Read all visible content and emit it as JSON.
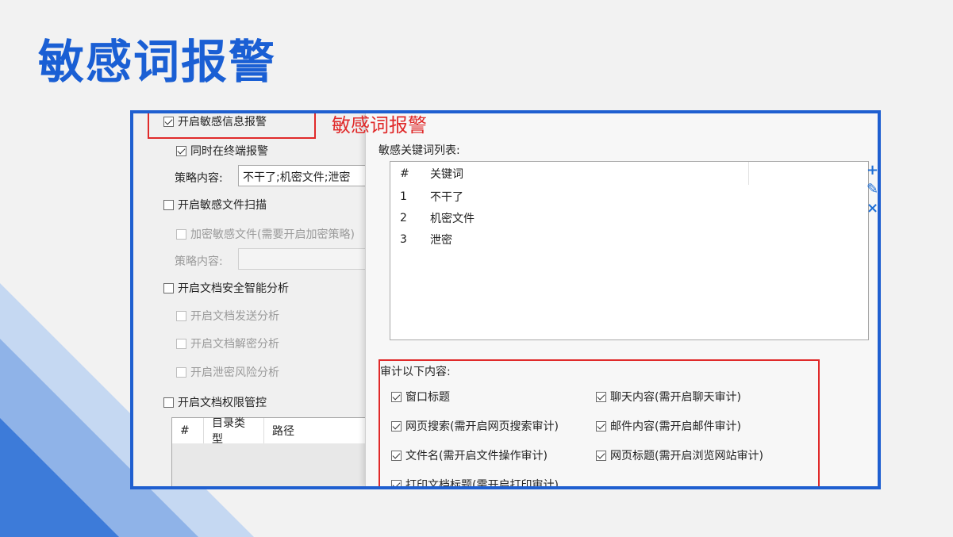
{
  "slide": {
    "title": "敏感词报警"
  },
  "left_panel": {
    "enable_sensitive_alarm": "开启敏感信息报警",
    "alarm_on_terminal": "同时在终端报警",
    "policy_label": "策略内容:",
    "policy_value": "不干了;机密文件;泄密",
    "enable_file_scan": "开启敏感文件扫描",
    "encrypt_sensitive": "加密敏感文件(需要开启加密策略)",
    "policy_label2": "策略内容:",
    "enable_doc_analysis": "开启文档安全智能分析",
    "doc_send_analysis": "开启文档发送分析",
    "doc_decrypt_analysis": "开启文档解密分析",
    "leak_risk_analysis": "开启泄密风险分析",
    "enable_doc_permission": "开启文档权限管控",
    "table_headers": [
      "#",
      "目录类型",
      "路径"
    ]
  },
  "annotation": {
    "red_label": "敏感词报警"
  },
  "right_panel": {
    "list_label": "敏感关键词列表:",
    "list_headers": [
      "#",
      "关键词"
    ],
    "keywords": [
      {
        "num": "1",
        "word": "不干了"
      },
      {
        "num": "2",
        "word": "机密文件"
      },
      {
        "num": "3",
        "word": "泄密"
      }
    ],
    "audit_label": "审计以下内容:",
    "audit_items": [
      "窗口标题",
      "聊天内容(需开启聊天审计)",
      "网页搜索(需开启网页搜索审计)",
      "邮件内容(需开启邮件审计)",
      "文件名(需开启文件操作审计)",
      "网页标题(需开启浏览网站审计)",
      "打印文档标题(需开启打印审计)"
    ]
  },
  "colors": {
    "title_blue": "#1a5fd4",
    "frame_blue": "#1f5fd0",
    "highlight_red": "#e02a2a"
  }
}
